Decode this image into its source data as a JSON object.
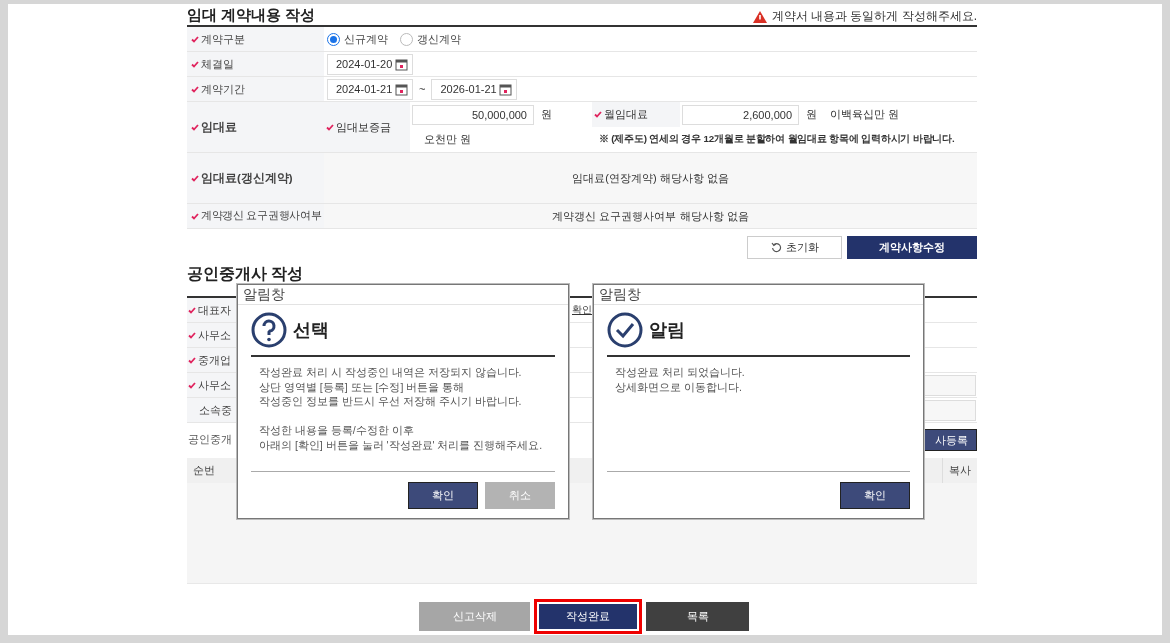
{
  "lease_section": {
    "title": "임대 계약내용 작성",
    "warning": "계약서 내용과 동일하게 작성해주세요.",
    "contract_type": {
      "label": "계약구분",
      "required": true,
      "options": [
        {
          "label": "신규계약",
          "selected": true
        },
        {
          "label": "갱신계약",
          "selected": false
        }
      ]
    },
    "signing_date": {
      "label": "체결일",
      "required": true,
      "value": "2024-01-20"
    },
    "period": {
      "label": "계약기간",
      "required": true,
      "start": "2024-01-21",
      "separator": "~",
      "end": "2026-01-21"
    },
    "rent": {
      "label": "임대료",
      "required": true,
      "deposit": {
        "label": "임대보증금",
        "required": true,
        "value": "50,000,000",
        "unit": "원",
        "in_words": "오천만 원"
      },
      "monthly": {
        "label": "월임대료",
        "required": true,
        "value": "2,600,000",
        "unit": "원",
        "in_words": "이백육십만 원"
      },
      "note": "※ (제주도) 연세의 경우 12개월로 분할하여 월임대료 항목에 입력하시기 바랍니다."
    },
    "renewal_rent": {
      "label": "임대료(갱신계약)",
      "required": true,
      "value": "임대료(연장계약) 해당사항 없음"
    },
    "renewal_right": {
      "label": "계약갱신 요구권행사여부",
      "required": true,
      "value": "계약갱신 요구권행사여부 해당사항 없음"
    },
    "buttons": [
      {
        "label": "초기화",
        "kind": "reset"
      },
      {
        "label": "계약사항수정",
        "kind": "primary"
      }
    ]
  },
  "agent_section": {
    "title": "공인중개사 작성",
    "rows": [
      {
        "label": "대표자",
        "required": true,
        "link": "확인"
      },
      {
        "label": "사무소",
        "required": true
      },
      {
        "label": "중개업",
        "required": true
      },
      {
        "label": "사무소",
        "required": true,
        "field": true
      },
      {
        "label": "소속중",
        "required": false,
        "field": true
      }
    ],
    "list_label": "공인중개",
    "register_button": "사등록",
    "columns": [
      "순번",
      "복사"
    ]
  },
  "dialogs": [
    {
      "title": "알림창",
      "kind": "question",
      "heading": "선택",
      "paragraphs": [
        [
          "작성완료 처리 시 작성중인 내역은 저장되지 않습니다.",
          "상단 영역별 [등록] 또는 [수정] 버튼을 통해",
          "작성중인 정보를 반드시 우선 저장해 주시기 바랍니다."
        ],
        [
          "작성한 내용을 등록/수정한 이후",
          "아래의 [확인] 버튼을 눌러 '작성완료' 처리를 진행해주세요."
        ]
      ],
      "buttons": [
        {
          "label": "확인",
          "kind": "primary"
        },
        {
          "label": "취소",
          "kind": "secondary"
        }
      ]
    },
    {
      "title": "알림창",
      "kind": "check",
      "heading": "알림",
      "paragraphs": [
        [
          "작성완료 처리 되었습니다.",
          "상세화면으로 이동합니다."
        ]
      ],
      "buttons": [
        {
          "label": "확인",
          "kind": "primary"
        }
      ]
    }
  ],
  "footer_buttons": [
    {
      "label": "신고삭제",
      "kind": "delete",
      "highlighted": false
    },
    {
      "label": "작성완료",
      "kind": "complete",
      "highlighted": true
    },
    {
      "label": "목록",
      "kind": "list",
      "highlighted": false
    }
  ]
}
